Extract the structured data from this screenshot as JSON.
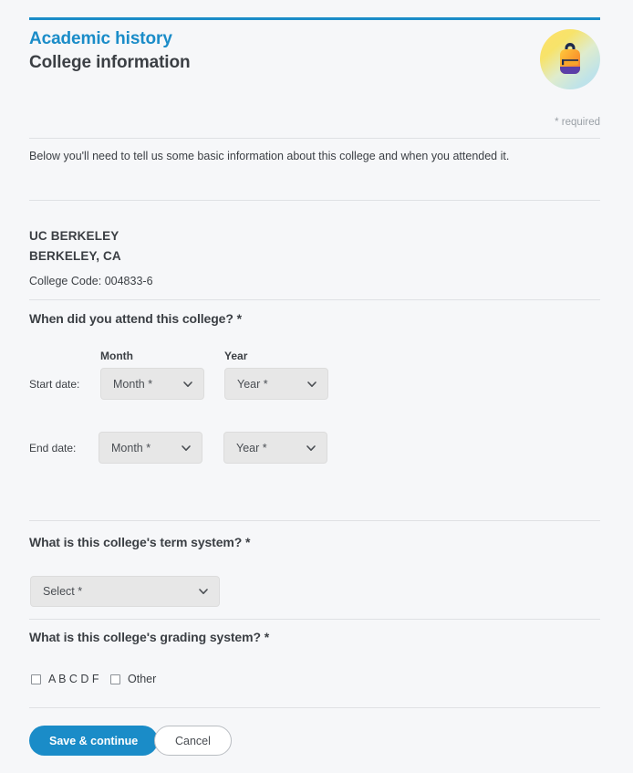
{
  "header": {
    "eyebrow": "Academic history",
    "title": "College information",
    "badge_icon": "backpack-icon",
    "accent_color": "#1a8cc8"
  },
  "required_note": "* required",
  "intro": "Below you'll need to tell us some basic information about this college and when you attended it.",
  "college": {
    "name": "UC BERKELEY",
    "city_state": "BERKELEY, CA",
    "code": "College Code: 004833-6"
  },
  "attendance": {
    "heading": "When did you attend this college? *",
    "column_headers": {
      "month": "Month",
      "year": "Year"
    },
    "rows": [
      {
        "label": "Start date:",
        "month": {
          "value": "Month *",
          "placeholder": "Month *"
        },
        "year": {
          "value": "Year *",
          "placeholder": "Year *"
        }
      },
      {
        "label": "End date:",
        "month": {
          "value": "Month *",
          "placeholder": "Month *"
        },
        "year": {
          "value": "Year *",
          "placeholder": "Year *"
        }
      }
    ]
  },
  "term_system": {
    "heading": "What is this college's term system? *",
    "select": {
      "value": "Select *",
      "placeholder": "Select *"
    }
  },
  "grading_system": {
    "heading": "What is this college's grading system? *",
    "options": [
      {
        "label": "A B C D F",
        "checked": false
      },
      {
        "label": "Other",
        "checked": false
      }
    ]
  },
  "footer": {
    "save_label": "Save & continue",
    "cancel_label": "Cancel"
  }
}
